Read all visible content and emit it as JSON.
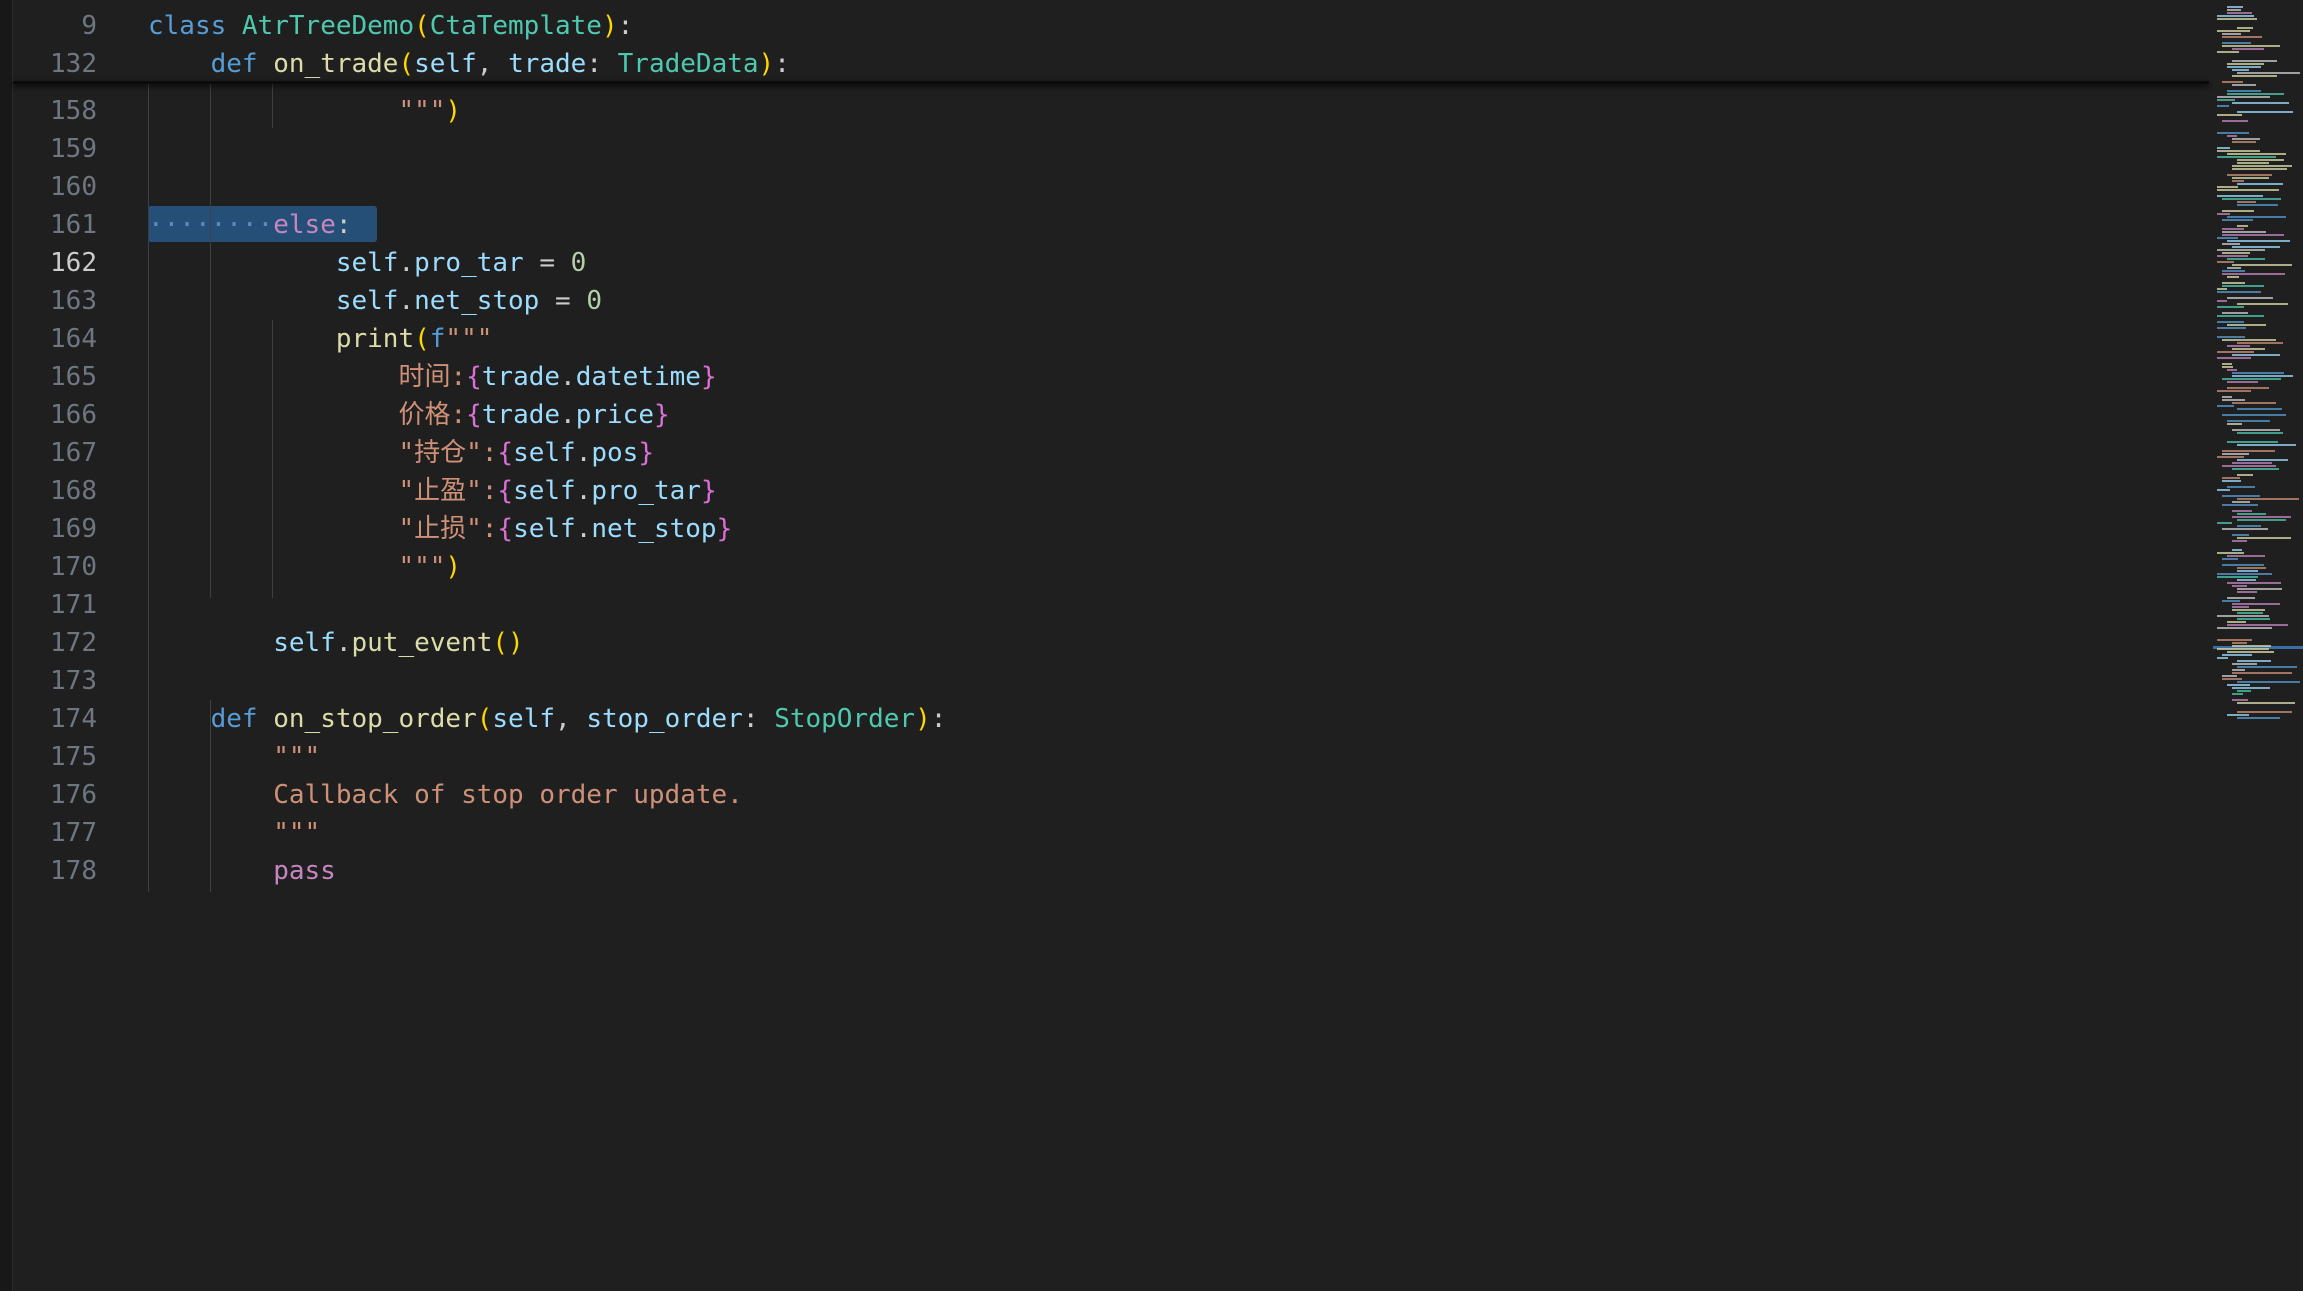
{
  "editor": {
    "active_line": 162,
    "lines": [
      {
        "num": "9",
        "segments": [
          {
            "t": "class ",
            "c": "kw"
          },
          {
            "t": "AtrTreeDemo",
            "c": "cls"
          },
          {
            "t": "(",
            "c": "p1"
          },
          {
            "t": "CtaTemplate",
            "c": "cls"
          },
          {
            "t": ")",
            "c": "p1"
          },
          {
            "t": ":",
            "c": "plain"
          }
        ]
      },
      {
        "num": "132",
        "segments": [
          {
            "t": "    def ",
            "c": "kw"
          },
          {
            "t": "on_trade",
            "c": "fn"
          },
          {
            "t": "(",
            "c": "p1"
          },
          {
            "t": "self",
            "c": "var"
          },
          {
            "t": ", ",
            "c": "plain"
          },
          {
            "t": "trade",
            "c": "var"
          },
          {
            "t": ": ",
            "c": "plain"
          },
          {
            "t": "TradeData",
            "c": "cls"
          },
          {
            "t": ")",
            "c": "p1"
          },
          {
            "t": ":",
            "c": "plain"
          }
        ]
      },
      {
        "num": "158",
        "segments": [
          {
            "t": "                \"\"\"",
            "c": "str"
          },
          {
            "t": ")",
            "c": "p1"
          }
        ]
      },
      {
        "num": "159",
        "segments": []
      },
      {
        "num": "160",
        "segments": []
      },
      {
        "num": "161",
        "segments": [
          {
            "t": "········",
            "c": "dots"
          },
          {
            "t": "else",
            "c": "kw2"
          },
          {
            "t": ":",
            "c": "plain"
          }
        ]
      },
      {
        "num": "162",
        "segments": [
          {
            "t": "            self",
            "c": "var"
          },
          {
            "t": ".",
            "c": "plain"
          },
          {
            "t": "pro_tar",
            "c": "var"
          },
          {
            "t": " = ",
            "c": "plain"
          },
          {
            "t": "0",
            "c": "num"
          }
        ]
      },
      {
        "num": "163",
        "segments": [
          {
            "t": "            self",
            "c": "var"
          },
          {
            "t": ".",
            "c": "plain"
          },
          {
            "t": "net_stop",
            "c": "var"
          },
          {
            "t": " = ",
            "c": "plain"
          },
          {
            "t": "0",
            "c": "num"
          }
        ]
      },
      {
        "num": "164",
        "segments": [
          {
            "t": "            print",
            "c": "fn"
          },
          {
            "t": "(",
            "c": "p1"
          },
          {
            "t": "f",
            "c": "kw"
          },
          {
            "t": "\"\"\"",
            "c": "str"
          }
        ]
      },
      {
        "num": "165",
        "segments": [
          {
            "t": "                时间:",
            "c": "str"
          },
          {
            "t": "{",
            "c": "p2"
          },
          {
            "t": "trade",
            "c": "var"
          },
          {
            "t": ".",
            "c": "plain"
          },
          {
            "t": "datetime",
            "c": "var"
          },
          {
            "t": "}",
            "c": "p2"
          }
        ]
      },
      {
        "num": "166",
        "segments": [
          {
            "t": "                价格:",
            "c": "str"
          },
          {
            "t": "{",
            "c": "p2"
          },
          {
            "t": "trade",
            "c": "var"
          },
          {
            "t": ".",
            "c": "plain"
          },
          {
            "t": "price",
            "c": "var"
          },
          {
            "t": "}",
            "c": "p2"
          }
        ]
      },
      {
        "num": "167",
        "segments": [
          {
            "t": "                \"持仓\":",
            "c": "str"
          },
          {
            "t": "{",
            "c": "p2"
          },
          {
            "t": "self",
            "c": "var"
          },
          {
            "t": ".",
            "c": "plain"
          },
          {
            "t": "pos",
            "c": "var"
          },
          {
            "t": "}",
            "c": "p2"
          }
        ]
      },
      {
        "num": "168",
        "segments": [
          {
            "t": "                \"止盈\":",
            "c": "str"
          },
          {
            "t": "{",
            "c": "p2"
          },
          {
            "t": "self",
            "c": "var"
          },
          {
            "t": ".",
            "c": "plain"
          },
          {
            "t": "pro_tar",
            "c": "var"
          },
          {
            "t": "}",
            "c": "p2"
          }
        ]
      },
      {
        "num": "169",
        "segments": [
          {
            "t": "                \"止损\":",
            "c": "str"
          },
          {
            "t": "{",
            "c": "p2"
          },
          {
            "t": "self",
            "c": "var"
          },
          {
            "t": ".",
            "c": "plain"
          },
          {
            "t": "net_stop",
            "c": "var"
          },
          {
            "t": "}",
            "c": "p2"
          }
        ]
      },
      {
        "num": "170",
        "segments": [
          {
            "t": "                \"\"\"",
            "c": "str"
          },
          {
            "t": ")",
            "c": "p1"
          }
        ]
      },
      {
        "num": "171",
        "segments": []
      },
      {
        "num": "172",
        "segments": [
          {
            "t": "        self",
            "c": "var"
          },
          {
            "t": ".",
            "c": "plain"
          },
          {
            "t": "put_event",
            "c": "fn"
          },
          {
            "t": "()",
            "c": "p1"
          }
        ]
      },
      {
        "num": "173",
        "segments": []
      },
      {
        "num": "174",
        "segments": [
          {
            "t": "    def ",
            "c": "kw"
          },
          {
            "t": "on_stop_order",
            "c": "fn"
          },
          {
            "t": "(",
            "c": "p1"
          },
          {
            "t": "self",
            "c": "var"
          },
          {
            "t": ", ",
            "c": "plain"
          },
          {
            "t": "stop_order",
            "c": "var"
          },
          {
            "t": ": ",
            "c": "plain"
          },
          {
            "t": "StopOrder",
            "c": "cls"
          },
          {
            "t": ")",
            "c": "p1"
          },
          {
            "t": ":",
            "c": "plain"
          }
        ]
      },
      {
        "num": "175",
        "segments": [
          {
            "t": "        \"\"\"",
            "c": "str"
          }
        ]
      },
      {
        "num": "176",
        "segments": [
          {
            "t": "        Callback of stop order update.",
            "c": "str"
          }
        ]
      },
      {
        "num": "177",
        "segments": [
          {
            "t": "        \"\"\"",
            "c": "str"
          }
        ]
      },
      {
        "num": "178",
        "segments": [
          {
            "t": "        pass",
            "c": "kw2"
          }
        ]
      }
    ]
  },
  "colors": {
    "background": "#1f1f1f",
    "selection": "#264f78",
    "keyword": "#569cd6",
    "class": "#4ec9b0",
    "function": "#dcdcaa",
    "variable": "#9cdcfe",
    "string": "#ce9178",
    "number": "#b5cea8"
  },
  "minimap": {
    "icon": "minimap"
  }
}
